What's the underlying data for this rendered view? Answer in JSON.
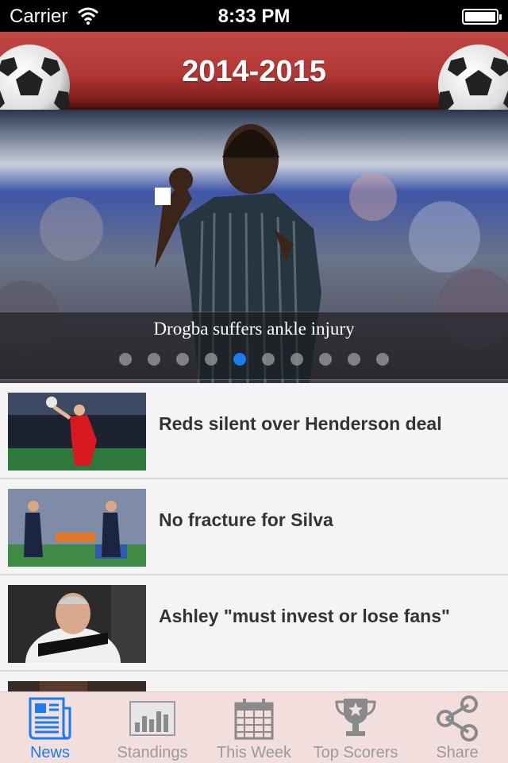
{
  "status_bar": {
    "carrier": "Carrier",
    "time": "8:33 PM"
  },
  "header": {
    "title": "2014-2015"
  },
  "carousel": {
    "caption": "Drogba suffers ankle injury",
    "page_count": 10,
    "active_index": 4,
    "active_dot_color": "#1a7cf0"
  },
  "news": [
    {
      "title": "Reds silent over Henderson deal"
    },
    {
      "title": "No fracture for Silva"
    },
    {
      "title": "Ashley \"must invest or lose fans\""
    },
    {
      "title": ""
    }
  ],
  "tab_bar": {
    "tabs": [
      {
        "label": "News",
        "icon": "newspaper-icon",
        "active": true
      },
      {
        "label": "Standings",
        "icon": "bar-chart-icon",
        "active": false
      },
      {
        "label": "This Week",
        "icon": "calendar-icon",
        "active": false
      },
      {
        "label": "Top Scorers",
        "icon": "trophy-icon",
        "active": false
      },
      {
        "label": "Share",
        "icon": "share-icon",
        "active": false
      }
    ]
  },
  "colors": {
    "header_red": "#b13835",
    "accent_blue": "#1a7cf0",
    "tab_bar_bg": "#f3dede"
  }
}
